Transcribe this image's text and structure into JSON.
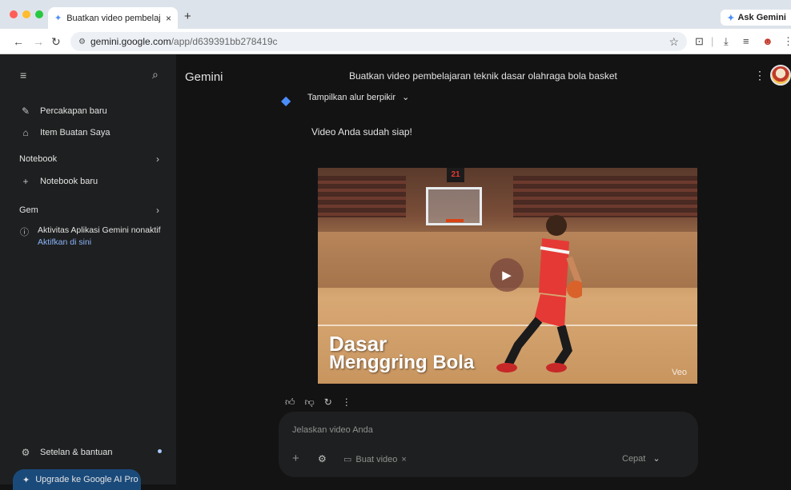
{
  "browser": {
    "tab_title": "Buatkan video pembelajaran",
    "tab_close": "×",
    "new_tab": "+",
    "ask_gemini": "Ask Gemini",
    "url_host": "gemini.google.com",
    "url_path": "/app/d639391bb278419c"
  },
  "sidebar": {
    "menu_icon": "≡",
    "search_icon": "⌕",
    "new_chat": "Percakapan baru",
    "my_items": "Item Buatan Saya",
    "notebook_section": "Notebook",
    "new_notebook": "Notebook baru",
    "gem_section": "Gem",
    "activity_title": "Aktivitas Aplikasi Gemini nonaktif",
    "activity_link": "Aktifkan di sini",
    "settings": "Setelan & bantuan",
    "upgrade": "Upgrade ke Google AI Pro"
  },
  "main": {
    "brand": "Gemini",
    "chat_title": "Buatkan video pembelajaran teknik dasar olahraga bola basket",
    "show_thinking": "Tampilkan alur berpikir",
    "response_text": "Video Anda sudah siap!",
    "video": {
      "overlay_line1": "Dasar",
      "overlay_line2": "Menggring Bola",
      "watermark": "Veo",
      "scoreboard": "21"
    }
  },
  "composer": {
    "placeholder": "Jelaskan video Anda",
    "chip_label": "Buat video",
    "chip_close": "×",
    "mode": "Cepat"
  },
  "colors": {
    "accent": "#4b8df8",
    "sidebar_bg": "#1e1f20",
    "main_bg": "#131314"
  }
}
